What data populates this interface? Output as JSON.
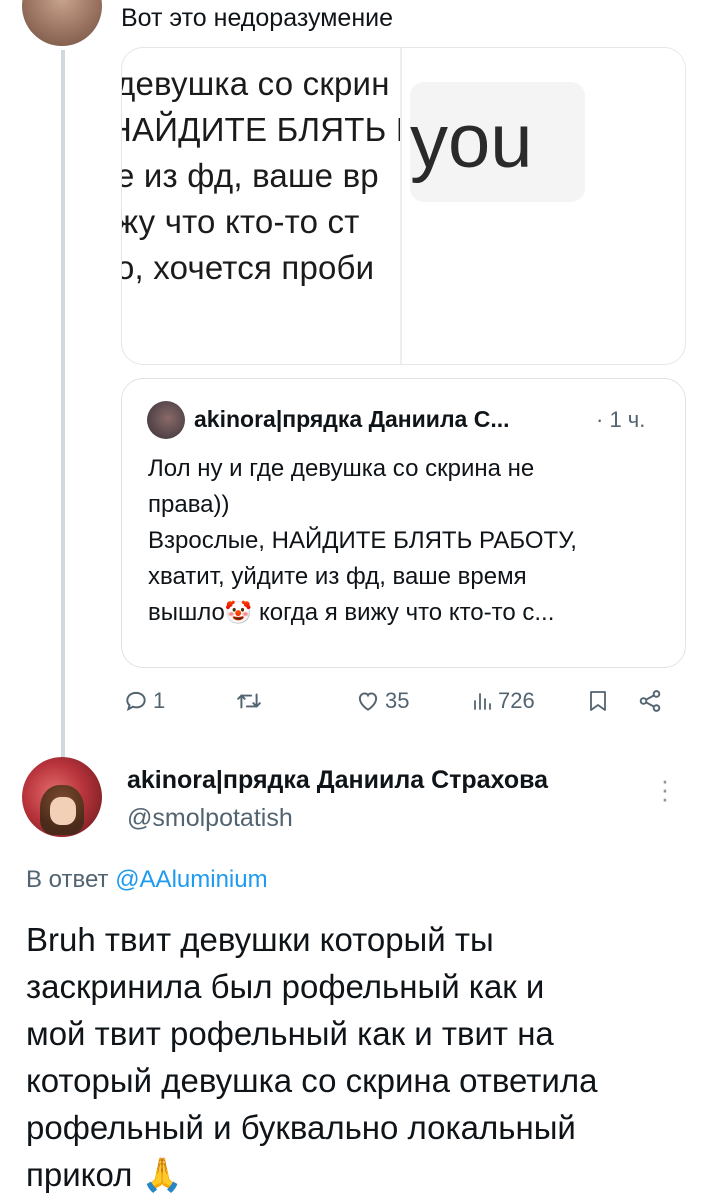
{
  "top_tweet": {
    "text": "Вот это недоразумение",
    "media": {
      "lines": [
        "девушка со скрин",
        "НАЙДИТЕ БЛЯТЬ Р",
        "е из фд, ваше вр",
        "жу что кто-то ст",
        "о, хочется проби"
      ],
      "overlay_text": "you"
    },
    "quote": {
      "author": "akinora|прядка Даниила С...",
      "separator": "·",
      "time": "1 ч.",
      "lines": [
        "Лол ну и где девушка со скрина не",
        "права))",
        "Взрослые, НАЙДИТЕ БЛЯТЬ РАБОТУ,",
        "хватит, уйдите из фд, ваше время"
      ],
      "last_line_start": "вышло",
      "emoji": "🤡",
      "last_line_end": " когда я вижу что кто-то с..."
    },
    "actions": {
      "replies": "1",
      "retweets": "",
      "likes": "35",
      "views": "726"
    }
  },
  "reply_tweet": {
    "author_name": "akinora|прядка Даниила Страхова",
    "handle": "@smolpotatish",
    "reply_prefix": "В ответ ",
    "reply_mention": "@AAluminium",
    "text_lines": [
      "Bruh твит девушки который ты",
      "заскринила был рофельный как и",
      "мой твит рофельный как и твит на",
      "который девушка со скрина ответила",
      "рофельный и буквально локальный"
    ],
    "text_last": "прикол ",
    "text_emoji": "🙏"
  },
  "colors": {
    "text": "#0f1419",
    "secondary": "#536471",
    "link": "#1d9bf0",
    "border": "#dfe4e7",
    "thread_line": "#cfd9de"
  }
}
